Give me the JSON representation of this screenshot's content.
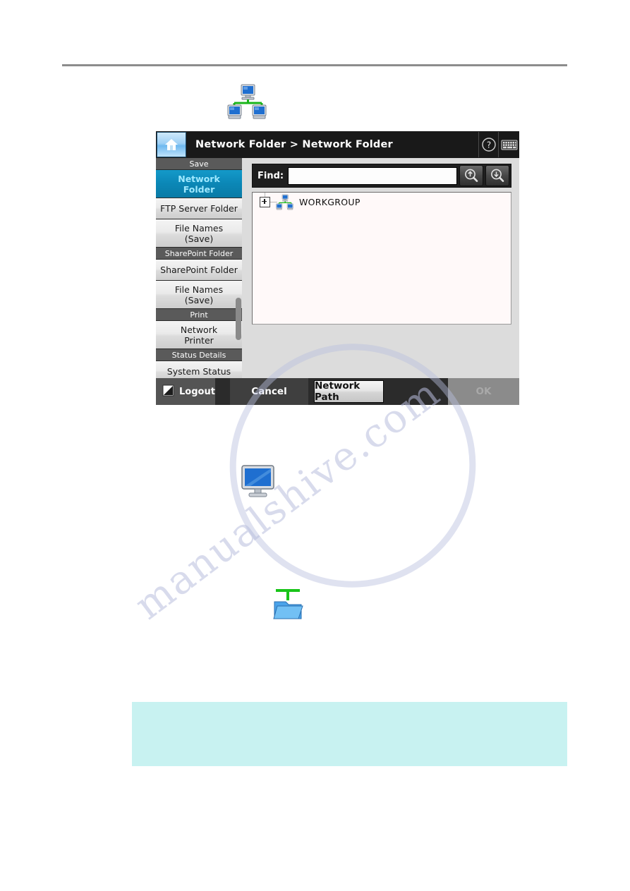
{
  "page": {
    "top_rule": true,
    "watermark_text": "manualshive.com"
  },
  "standalone_icons": [
    {
      "name": "network-workgroup-icon",
      "label": "network-computers"
    },
    {
      "name": "computer-monitor-icon",
      "label": "computer"
    },
    {
      "name": "network-folder-icon",
      "label": "shared-folder"
    }
  ],
  "device": {
    "header": {
      "home_icon": "home-icon",
      "breadcrumb": "Network Folder > Network Folder",
      "help_icon": "help-question-icon",
      "keyboard_icon": "keyboard-icon"
    },
    "sidebar": {
      "items": [
        {
          "type": "group",
          "label": "Save"
        },
        {
          "type": "item",
          "label": "Network\nFolder",
          "selected": true,
          "size": "tall"
        },
        {
          "type": "item",
          "label": "FTP Server Folder",
          "selected": false,
          "size": "short"
        },
        {
          "type": "item",
          "label": "File Names\n(Save)",
          "selected": false,
          "size": "tall"
        },
        {
          "type": "group",
          "label": "SharePoint Folder"
        },
        {
          "type": "item",
          "label": "SharePoint Folder",
          "selected": false,
          "size": "short"
        },
        {
          "type": "item",
          "label": "File Names\n(Save)",
          "selected": false,
          "size": "tall"
        },
        {
          "type": "group",
          "label": "Print"
        },
        {
          "type": "item",
          "label": "Network\nPrinter",
          "selected": false,
          "size": "tall"
        },
        {
          "type": "group",
          "label": "Status Details"
        },
        {
          "type": "item",
          "label": "System Status",
          "selected": false,
          "size": "short"
        }
      ],
      "scrollbar": {
        "visible": true
      }
    },
    "find": {
      "label": "Find:",
      "value": "",
      "placeholder": "",
      "search_up_icon": "search-up-icon",
      "search_down_icon": "search-down-icon"
    },
    "tree": {
      "rows": [
        {
          "expander": "plus",
          "icon": "network-workgroup-icon",
          "label": "WORKGROUP"
        }
      ]
    },
    "toolbar": {
      "logout_label": "Logout",
      "logout_icon": "logout-icon",
      "cancel_label": "Cancel",
      "network_path_label": "Network Path",
      "ok_label": "OK",
      "ok_disabled": true
    }
  },
  "note": {
    "text": "",
    "background": "#c8f2f1"
  },
  "colors": {
    "accent_selected": "#0b87b6",
    "selected_text": "#9fe9ff",
    "header_bg": "#191919",
    "device_bg": "#2b2b2b",
    "group_bg": "#5a5a5a",
    "note_bg": "#c8f2f1",
    "rule": "#8c8c8c"
  }
}
